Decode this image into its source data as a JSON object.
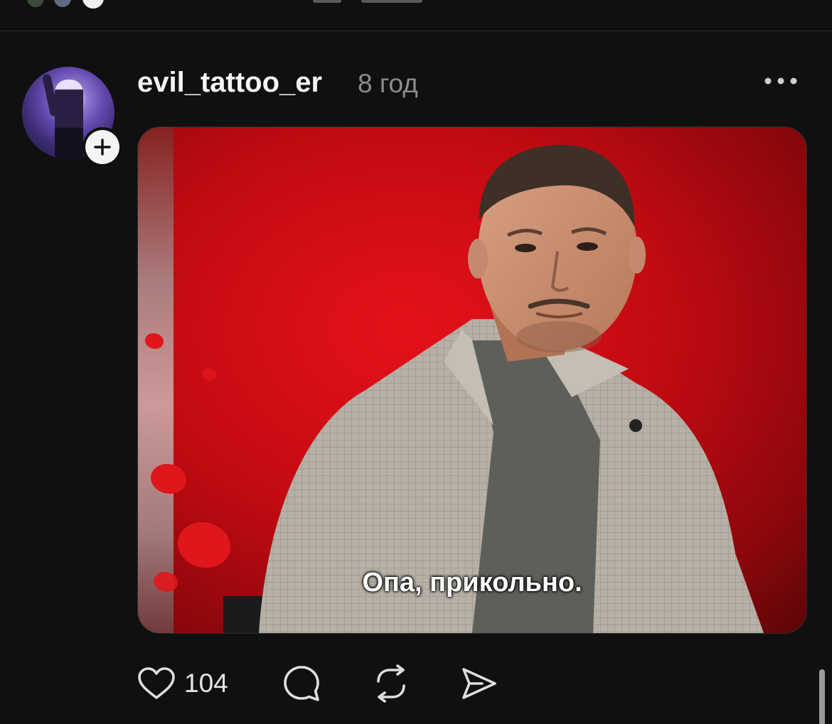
{
  "post": {
    "username": "evil_tattoo_er",
    "time_ago": "8 год",
    "caption_in_media": "Опа, прикольно.",
    "likes": "104"
  },
  "icons": {
    "follow": "plus-icon",
    "more": "ellipsis-icon",
    "like": "heart-icon",
    "comment": "comment-icon",
    "repost": "repost-icon",
    "share": "send-icon"
  },
  "colors": {
    "background": "#101010",
    "text_primary": "#f5f5f5",
    "text_secondary": "#8b8b8b",
    "media_red": "#d3131a"
  }
}
